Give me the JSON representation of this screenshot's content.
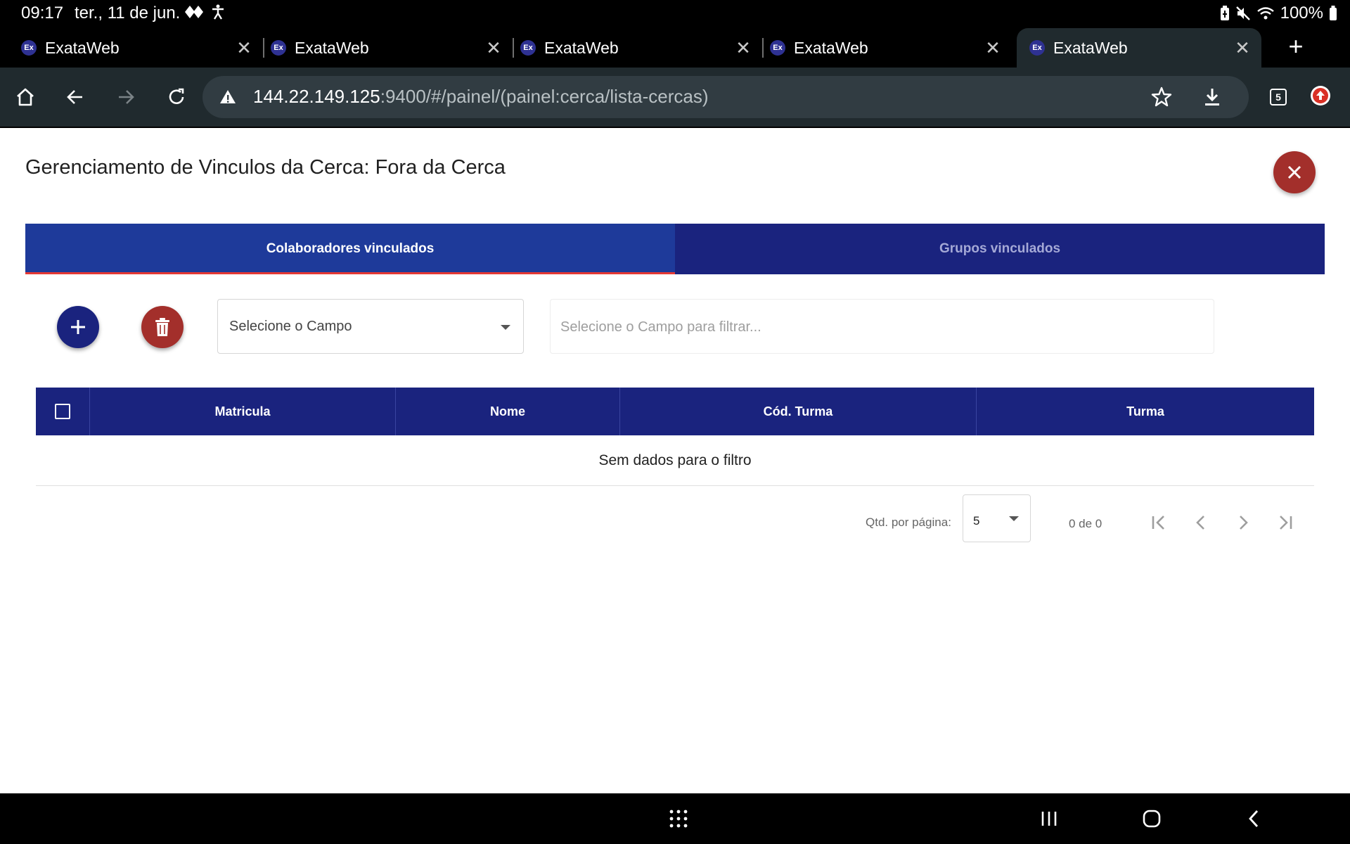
{
  "status_bar": {
    "time": "09:17",
    "date": "ter., 11 de jun.",
    "battery": "100%",
    "icons": [
      "diamond-icon",
      "accessibility-icon",
      "battery-saver-icon",
      "mute-icon",
      "wifi-icon",
      "battery-icon"
    ]
  },
  "browser": {
    "tabs": [
      {
        "favicon": "Ex",
        "title": "ExataWeb",
        "active": false
      },
      {
        "favicon": "Ex",
        "title": "ExataWeb",
        "active": false
      },
      {
        "favicon": "Ex",
        "title": "ExataWeb",
        "active": false
      },
      {
        "favicon": "Ex",
        "title": "ExataWeb",
        "active": false
      },
      {
        "favicon": "Ex",
        "title": "ExataWeb",
        "active": true
      }
    ],
    "url_host": "144.22.149.125",
    "url_rest": ":9400/#/painel/(painel:cerca/lista-cercas)",
    "tab_count": "5"
  },
  "page": {
    "title": "Gerenciamento de Vinculos da Cerca: Fora da Cerca",
    "tabs": {
      "collaborators": "Colaboradores vinculados",
      "groups": "Grupos vinculados"
    },
    "field_select": {
      "value": "Selecione o Campo"
    },
    "filter": {
      "placeholder": "Selecione o Campo para filtrar..."
    },
    "table": {
      "columns": [
        "Matricula",
        "Nome",
        "Cód. Turma",
        "Turma"
      ],
      "empty_message": "Sem dados para o filtro"
    },
    "paginator": {
      "label": "Qtd. por página:",
      "page_size": "5",
      "range": "0 de 0"
    }
  },
  "colors": {
    "primary": "#1a237e",
    "active_tab": "#1e3a9a",
    "danger": "#a32f2b",
    "tab_indicator": "#e53935"
  }
}
